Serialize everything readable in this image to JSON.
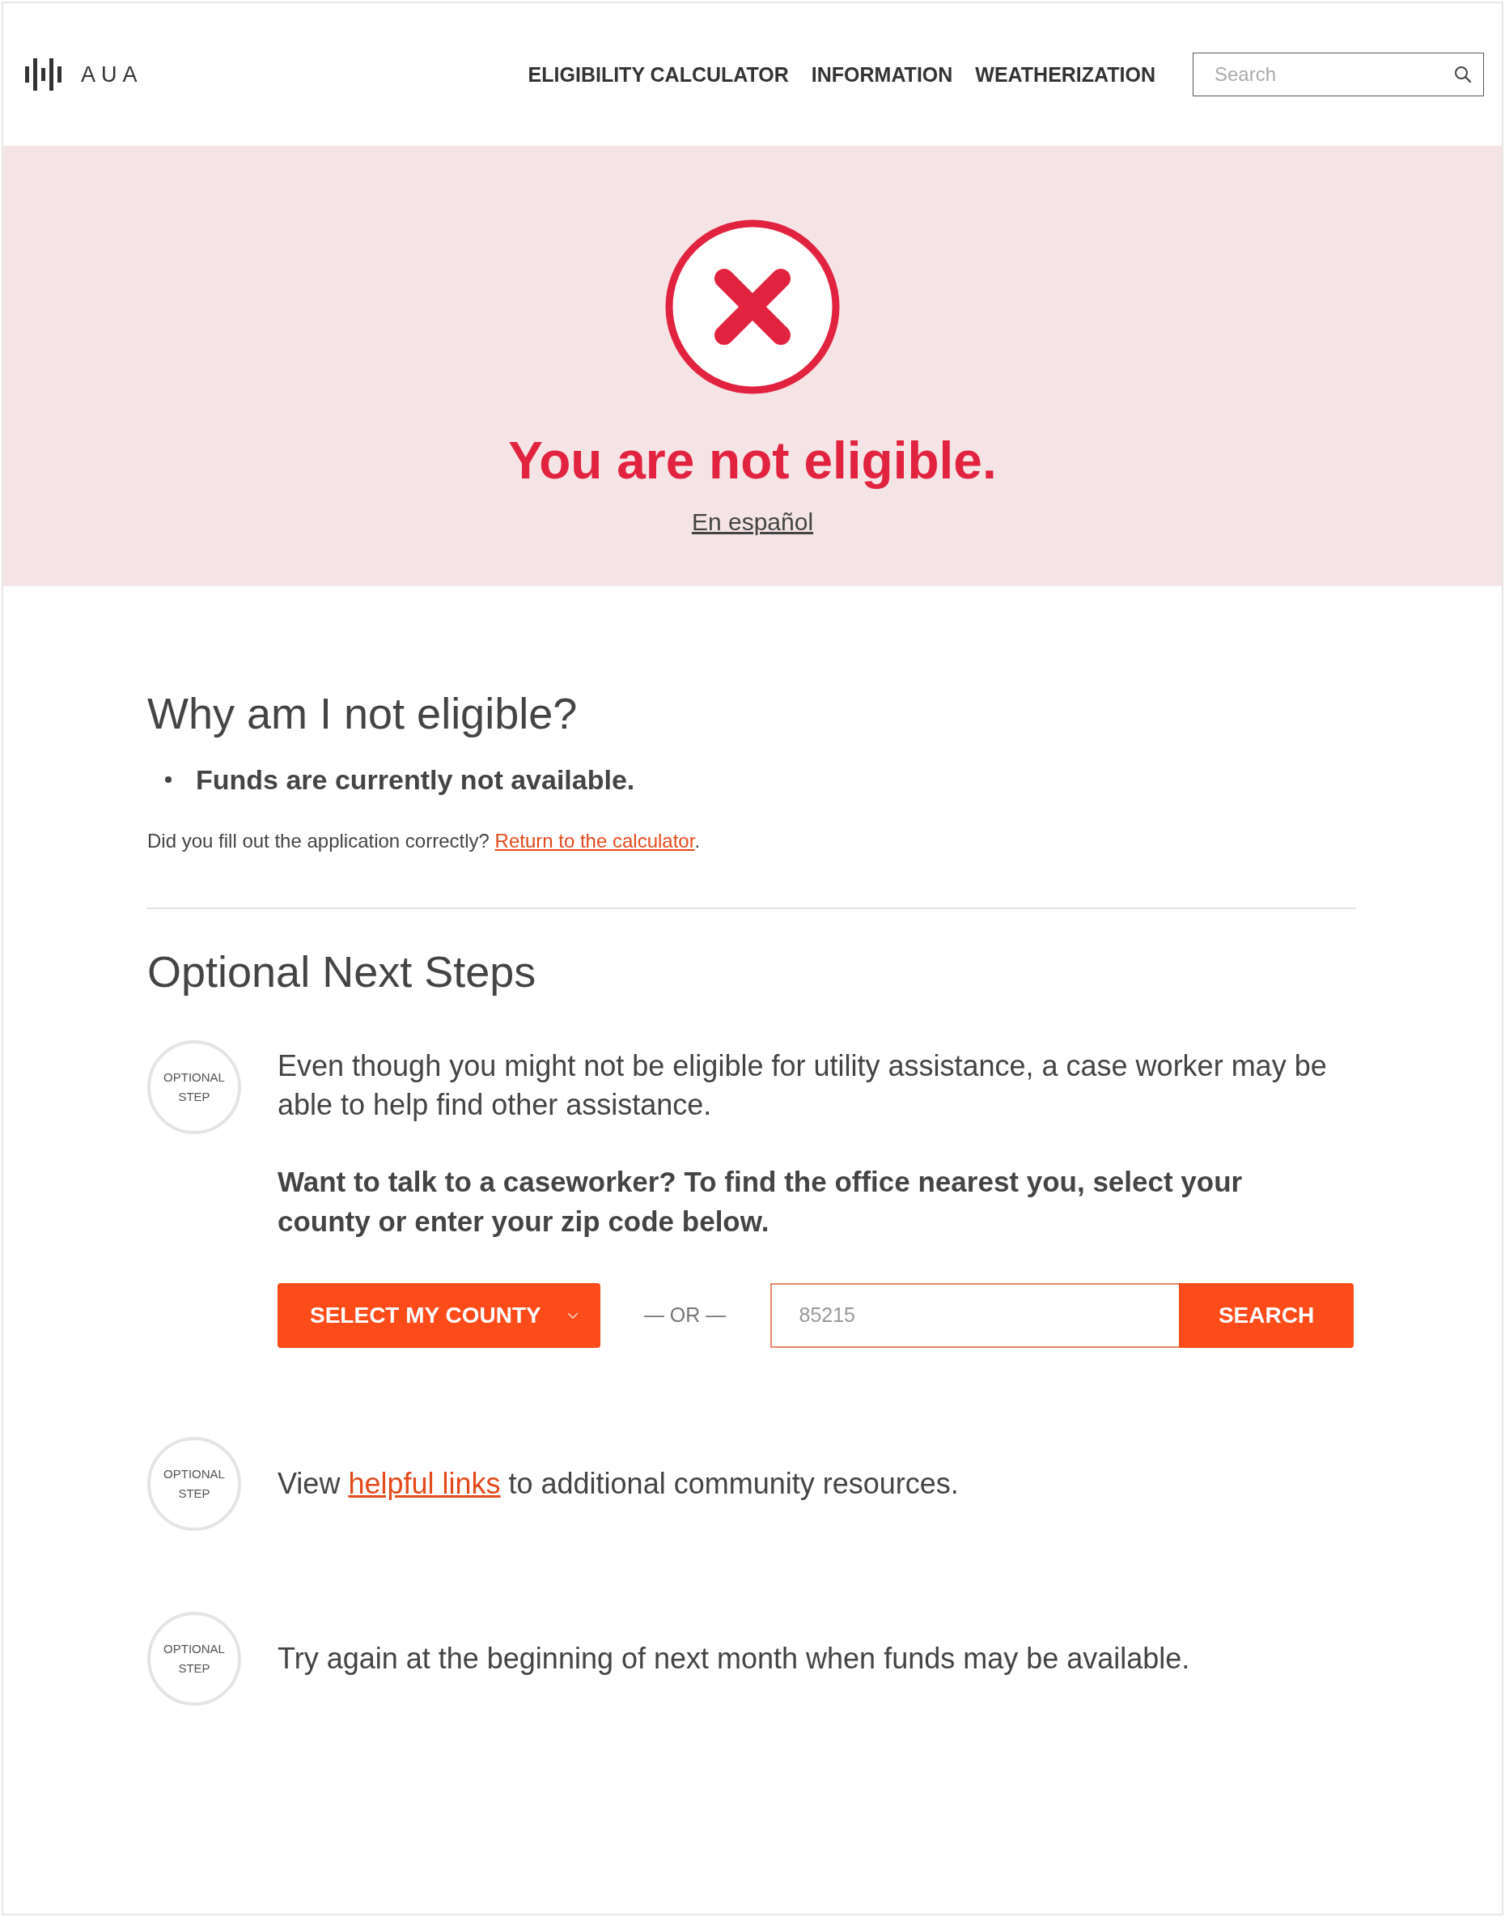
{
  "header": {
    "logo_text": "AUA",
    "nav": [
      {
        "label": "ELIGIBILITY CALCULATOR"
      },
      {
        "label": "INFORMATION"
      },
      {
        "label": "WEATHERIZATION"
      }
    ],
    "search": {
      "placeholder": "Search"
    }
  },
  "banner": {
    "title": "You are not eligible.",
    "language_link": "En español"
  },
  "reasons": {
    "heading": "Why am I not eligible?",
    "items": [
      "Funds are currently not available."
    ],
    "note_before": "Did you fill out the application correctly? ",
    "note_link": "Return to the calculator",
    "note_after": "."
  },
  "next_steps": {
    "heading": "Optional Next Steps",
    "steps": [
      {
        "kind": "caseworker",
        "badge_top": "OPTIONAL",
        "badge_bottom": "STEP",
        "text": "Even though you might not be eligible for utility assistance, a case worker may be able to help find other assistance.",
        "prompt": "Want to talk to a caseworker? To find the office nearest you, select your county or enter your zip code below.",
        "county_button": "SELECT MY COUNTY",
        "separator": "— OR —",
        "zip_placeholder": "85215",
        "search_button": "SEARCH"
      },
      {
        "kind": "link",
        "badge_top": "OPTIONAL",
        "badge_bottom": "STEP",
        "text_before": "View ",
        "link": "helpful links",
        "text_after": " to additional community resources."
      },
      {
        "kind": "text",
        "badge_top": "OPTIONAL",
        "badge_bottom": "STEP",
        "text": "Try again at the beginning of next month when funds may be available."
      }
    ]
  }
}
